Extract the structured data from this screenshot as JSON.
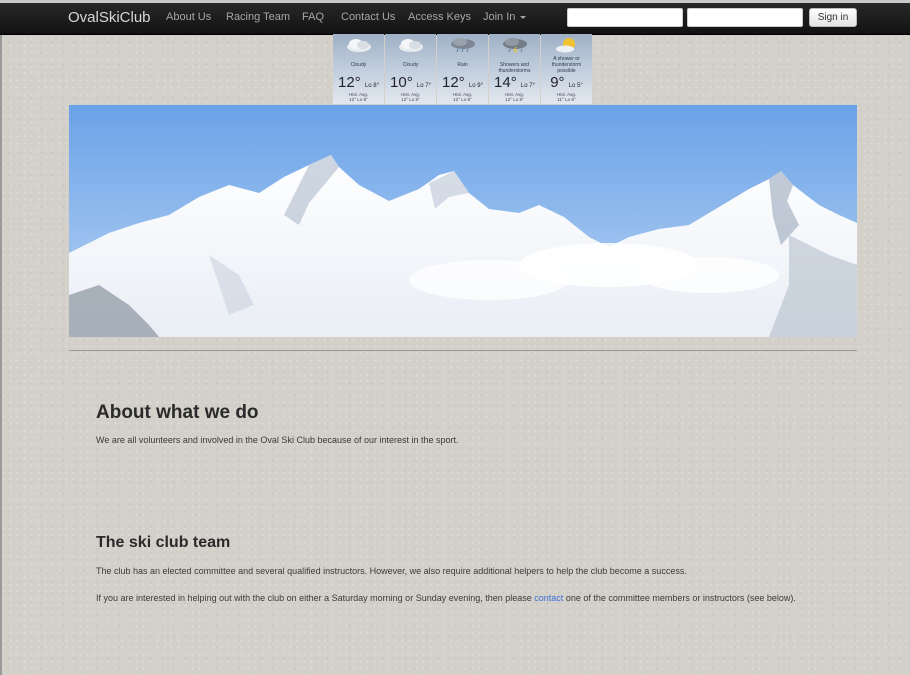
{
  "navbar": {
    "brand": "OvalSkiClub",
    "items": [
      {
        "label": "About Us"
      },
      {
        "label": "Racing Team"
      },
      {
        "label": "FAQ"
      },
      {
        "label": "Contact Us"
      },
      {
        "label": "Access Keys"
      },
      {
        "label": "Join In"
      }
    ],
    "username_placeholder": "",
    "password_placeholder": "",
    "signin_label": "Sign in"
  },
  "weather": [
    {
      "condition": "Cloudy",
      "hi": "12°",
      "lo": "Lo 8°",
      "avg_label": "Hist. Avg.",
      "avg": "12° Lo 8°",
      "icon": "cloud-icon"
    },
    {
      "condition": "Cloudy",
      "hi": "10°",
      "lo": "Lo 7°",
      "avg_label": "Hist. Avg.",
      "avg": "12° Lo 8°",
      "icon": "cloud-icon"
    },
    {
      "condition": "Rain",
      "hi": "12°",
      "lo": "Lo 9°",
      "avg_label": "Hist. Avg.",
      "avg": "12° Lo 8°",
      "icon": "rain-cloud-icon"
    },
    {
      "condition": "Showers and thunderstorms",
      "hi": "14°",
      "lo": "Lo 7°",
      "avg_label": "Hist. Avg.",
      "avg": "12° Lo 8°",
      "icon": "thunderstorm-icon"
    },
    {
      "condition": "A shower or thunderstorm possible",
      "hi": "9°",
      "lo": "Lo 5°",
      "avg_label": "Hist. Avg.",
      "avg": "11° Lo 8°",
      "icon": "sun-cloud-icon"
    }
  ],
  "about": {
    "heading": "About what we do",
    "text": "We are all volunteers and involved in the Oval Ski Club because of our interest in the sport."
  },
  "team": {
    "heading": "The ski club team",
    "text1": "The club has an elected committee and several qualified instructors. However, we also require additional helpers to help the club become a success.",
    "text2_before": "If you are interested in helping out with the club on either a Saturday morning or Sunday evening, then please ",
    "link": "contact",
    "text2_after": " one of the committee members or instructors (see below)."
  },
  "colors": {
    "navbar": "#1b1b1b",
    "link": "#3a6fd8",
    "page_bg": "#d3d0ca"
  }
}
